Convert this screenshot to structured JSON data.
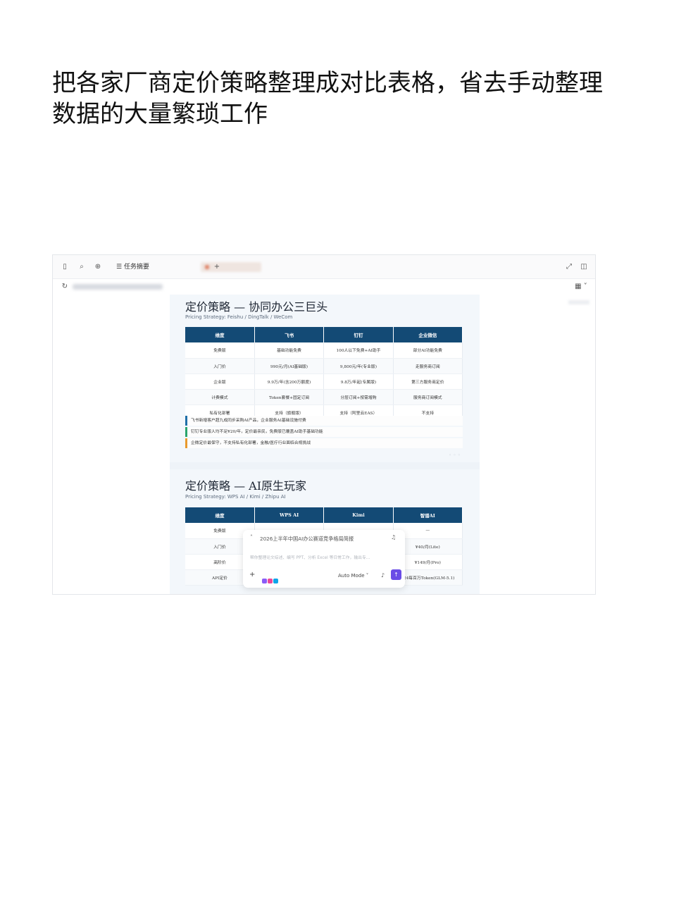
{
  "headline": "把各家厂商定价策略整理成对比表格，省去手动整理数据的大量繁琐工作",
  "app": {
    "tabs": {
      "active_label": "任务摘要",
      "add_label": "+"
    },
    "icons": {
      "sidebar": "sidebar-toggle-icon",
      "search": "search-icon",
      "new_chat": "new-chat-icon",
      "list": "list-icon",
      "expand": "expand-icon",
      "panel": "panel-icon",
      "reload": "reload-icon",
      "grid": "grid-icon"
    }
  },
  "slides": [
    {
      "title": "定价策略 — 协同办公三巨头",
      "subtitle": "Pricing Strategy: Feishu / DingTalk / WeCom",
      "columns": [
        "维度",
        "飞书",
        "钉钉",
        "企业微信"
      ],
      "rows": [
        [
          "免费版",
          "基础功能免费",
          "100人以下免费+AI助手",
          "部分AI功能免费"
        ],
        [
          "入门价",
          "990元/月(AI基础版)",
          "9,800元/年(专业版)",
          "走服务商订阅"
        ],
        [
          "企业版",
          "9.9万/年(含200万额度)",
          "9.8万/年起(专属版)",
          "第三方服务商定价"
        ],
        [
          "计费模式",
          "Token套餐+固定订阅",
          "分层订阅+按需增购",
          "服务商订阅模式"
        ],
        [
          "私有化部署",
          "支持（旗舰版）",
          "支持（阿里云EAS）",
          "不支持"
        ]
      ],
      "notes": [
        {
          "text": "飞书新增客户超九成同步采购AI产品，企业服务AI基础设施付费",
          "color": "#1f6fa8"
        },
        {
          "text": "钉钉专业版人均不足¥20/年，定价最亲民，免费版已覆盖AI助手基础功能",
          "color": "#2aa56d"
        },
        {
          "text": "企微定价最保守，不支持私有化部署，金融/医疗行业面临合规挑战",
          "color": "#e89a2e"
        }
      ]
    },
    {
      "title": "定价策略 — AI原生玩家",
      "subtitle": "Pricing Strategy: WPS AI / Kimi / Zhipu AI",
      "columns": [
        "维度",
        "WPS AI",
        "Kimi",
        "智谱AI"
      ],
      "rows": [
        [
          "免费版",
          "",
          "",
          "—"
        ],
        [
          "入门价",
          "",
          "",
          "¥40/月(Lite)"
        ],
        [
          "高阶价",
          "",
          "",
          "¥149/月(Pro)"
        ],
        [
          "API定价",
          "",
          "",
          "¥24每百万Token(GLM-5.1)"
        ]
      ]
    }
  ],
  "chat": {
    "title": "2026上半年中国AI办公赛道竞争格局简报",
    "placeholder": "帮你整理论文综述、编写 PPT、分析 Excel 等日常工作，输出专...",
    "mode": "Auto Mode",
    "plus_label": "+",
    "send_label": "↑"
  }
}
